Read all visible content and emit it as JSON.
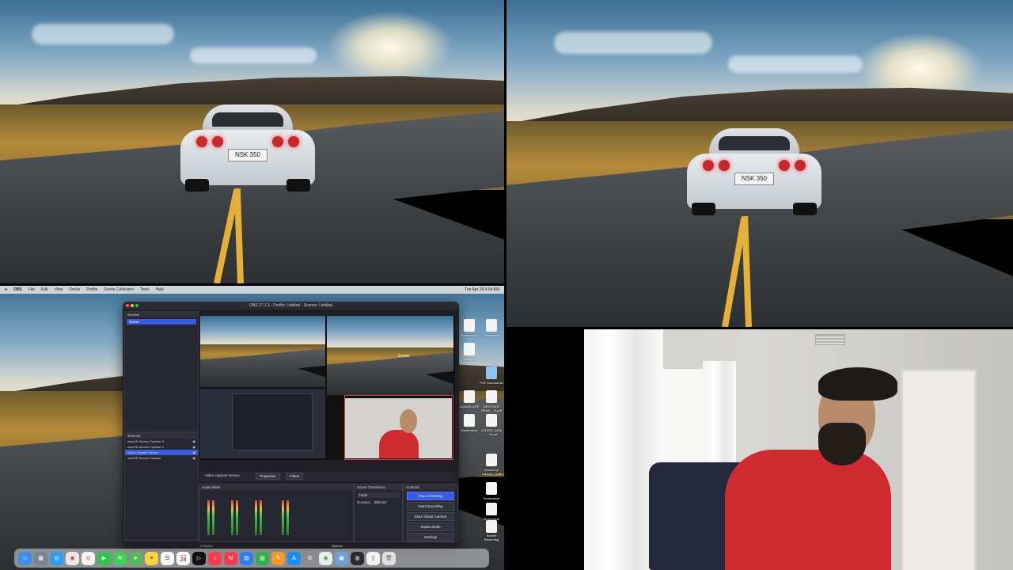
{
  "menubar": {
    "items": [
      "OBS",
      "File",
      "Edit",
      "View",
      "Docks",
      "Profile",
      "Scene Collection",
      "Tools",
      "Help"
    ],
    "clock": "Tue Apr 26  9:54 AM"
  },
  "obs": {
    "title": "OBS 27.1.3 - Profile: Untitled - Scenes: Untitled",
    "scenes_header": "Scenes",
    "scenes": [
      "Scene"
    ],
    "sources_header": "Sources",
    "sources": [
      "macOS Screen Capture 3",
      "macOS Screen Capture 2",
      "Video Capture Device",
      "macOS Screen Capture"
    ],
    "selected_source": "Video Capture Device",
    "source_toolbar": {
      "device_label": "Video Capture Device",
      "properties": "Properties",
      "filters": "Filters"
    },
    "audio_mixer_header": "Audio Mixer",
    "transitions_header": "Scene Transitions",
    "transition_value": "Fade",
    "duration_label": "Duration",
    "duration_value": "300 ms",
    "controls_header": "Controls",
    "controls": [
      "Stop Streaming",
      "Start Recording",
      "Start Virtual Camera",
      "Studio Mode",
      "Settings"
    ],
    "status_right": "Options",
    "status_left": "0 Hidden"
  },
  "car_plate": "NSK 350",
  "preview_overlay_label": "Scene",
  "desktop_icons": [
    {
      "label": "Screenshot"
    },
    {
      "label": "Screenshot"
    },
    {
      "label": "Untitled"
    },
    {
      "label": "PDF Documents"
    },
    {
      "label": "LANDSCAPE"
    },
    {
      "label": "BROTHER PRINT... R.pdf"
    },
    {
      "label": "Screenshot"
    },
    {
      "label": "GOODS_2022 ... E.pdf"
    },
    {
      "label": "Invoice for Lapsus_1.pdf"
    },
    {
      "label": "Screenshot"
    },
    {
      "label": "Screenshot"
    },
    {
      "label": "Screen Recording"
    }
  ],
  "dock": {
    "calendar_day": "28",
    "calendar_month": "APR",
    "apps": [
      "finder-icon",
      "launchpad-icon",
      "safari-icon",
      "chrome-icon",
      "photos-icon",
      "facetime-icon",
      "messages-icon",
      "maps-icon",
      "notes-icon",
      "reminders-icon",
      "calendar-icon",
      "appletv-icon",
      "music-icon",
      "news-icon",
      "keynote-icon",
      "numbers-icon",
      "pages-icon",
      "appstore-icon",
      "settings-icon",
      "obs-icon",
      "preview-icon",
      "trash-icon"
    ]
  },
  "colors": {
    "obs_accent": "#3b5bdb",
    "shirt": "#cf2b31",
    "road_line": "#e5b03a"
  }
}
